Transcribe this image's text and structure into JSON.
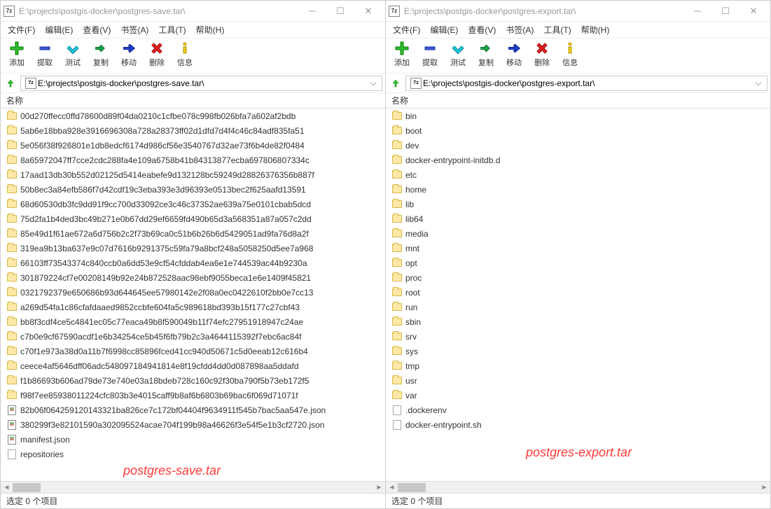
{
  "left": {
    "title": "E:\\projects\\postgis-docker\\postgres-save.tar\\",
    "menu": [
      "文件(F)",
      "编辑(E)",
      "查看(V)",
      "书签(A)",
      "工具(T)",
      "帮助(H)"
    ],
    "toolbar": [
      "添加",
      "提取",
      "测试",
      "复制",
      "移动",
      "删除",
      "信息"
    ],
    "address": "E:\\projects\\postgis-docker\\postgres-save.tar\\",
    "column_header": "名称",
    "items": [
      {
        "type": "folder",
        "name": "00d270ffecc0ffd78600d89f04da0210c1cfbe078c998fb026bfa7a602af2bdb"
      },
      {
        "type": "folder",
        "name": "5ab6e18bba928e3916696308a728a28373ff02d1dfd7d4f4c46c84adf835fa51"
      },
      {
        "type": "folder",
        "name": "5e056f38f926801e1db8edcf6174d986cf56e3540767d32ae73f6b4de82f0484"
      },
      {
        "type": "folder",
        "name": "8a65972047ff7cce2cdc288fa4e109a6758b41b84313877ecba697806807334c"
      },
      {
        "type": "folder",
        "name": "17aad13db30b552d02125d5414eabefe9d132128bc59249d28826376356b887f"
      },
      {
        "type": "folder",
        "name": "50b8ec3a84efb586f7d42cdf19c3eba393e3d96393e0513bec2f625aafd13591"
      },
      {
        "type": "folder",
        "name": "68d60530db3fc9dd91f9cc700d33092ce3c46c37352ae639a75e0101cbab5dcd"
      },
      {
        "type": "folder",
        "name": "75d2fa1b4ded3bc49b271e0b67dd29ef6659fd490b65d3a568351a87a057c2dd"
      },
      {
        "type": "folder",
        "name": "85e49d1f61ae672a6d756b2c2f73b69ca0c51b6b26b6d5429051ad9fa76d8a2f"
      },
      {
        "type": "folder",
        "name": "319ea9b13ba637e9c07d7616b9291375c59fa79a8bcf248a5058250d5ee7a968"
      },
      {
        "type": "folder",
        "name": "66103ff73543374c840ccb0a6dd53e9cf54cfddab4ea6e1e744539ac44b9230a"
      },
      {
        "type": "folder",
        "name": "301879224cf7e00208149b92e24b872528aac98ebf9055beca1e6e1409f45821"
      },
      {
        "type": "folder",
        "name": "0321792379e650686b93d644645ee57980142e2f08a0ec0422610f2bb0e7cc13"
      },
      {
        "type": "folder",
        "name": "a269d54fa1c86cfafdaaed9852ccbfe604fa5c989618bd393b15f177c27cbf43"
      },
      {
        "type": "folder",
        "name": "bb8f3cdf4ce5c4841ec05c77eaca49b8f590049b11f74efc27951918947c24ae"
      },
      {
        "type": "folder",
        "name": "c7b0e9cf67590acdf1e6b34254ce5b45f6fb79b2c3a4644115392f7ebc6ac84f"
      },
      {
        "type": "folder",
        "name": "c70f1e973a38d0a11b7f6998cc85896fced41cc940d50671c5d0eeab12c616b4"
      },
      {
        "type": "folder",
        "name": "ceece4af5646dff06adc548097184941814e8f19cfdd4dd0d087898aa5ddafd"
      },
      {
        "type": "folder",
        "name": "f1b86693b606ad79de73e740e03a18bdeb728c160c92f30ba790f5b73eb172f5"
      },
      {
        "type": "folder",
        "name": "f98f7ee85938011224cfc803b3e4015caff9b8af6b6803b69bac6f069d71071f"
      },
      {
        "type": "json",
        "name": "82b06f064259120143321ba826ce7c172bf04404f9634911f545b7bac5aa547e.json"
      },
      {
        "type": "json",
        "name": "380299f3e82101590a302095524acae704f199b98a46626f3e54f5e1b3cf2720.json"
      },
      {
        "type": "json",
        "name": "manifest.json"
      },
      {
        "type": "file",
        "name": "repositories"
      }
    ],
    "annotation": "postgres-save.tar",
    "status": "选定 0 个项目"
  },
  "right": {
    "title": "E:\\projects\\postgis-docker\\postgres-export.tar\\",
    "menu": [
      "文件(F)",
      "编辑(E)",
      "查看(V)",
      "书签(A)",
      "工具(T)",
      "帮助(H)"
    ],
    "toolbar": [
      "添加",
      "提取",
      "测试",
      "复制",
      "移动",
      "删除",
      "信息"
    ],
    "address": "E:\\projects\\postgis-docker\\postgres-export.tar\\",
    "column_header": "名称",
    "items": [
      {
        "type": "folder",
        "name": "bin"
      },
      {
        "type": "folder",
        "name": "boot"
      },
      {
        "type": "folder",
        "name": "dev"
      },
      {
        "type": "folder",
        "name": "docker-entrypoint-initdb.d"
      },
      {
        "type": "folder",
        "name": "etc"
      },
      {
        "type": "folder",
        "name": "home"
      },
      {
        "type": "folder",
        "name": "lib"
      },
      {
        "type": "folder",
        "name": "lib64"
      },
      {
        "type": "folder",
        "name": "media"
      },
      {
        "type": "folder",
        "name": "mnt"
      },
      {
        "type": "folder",
        "name": "opt"
      },
      {
        "type": "folder",
        "name": "proc"
      },
      {
        "type": "folder",
        "name": "root"
      },
      {
        "type": "folder",
        "name": "run"
      },
      {
        "type": "folder",
        "name": "sbin"
      },
      {
        "type": "folder",
        "name": "srv"
      },
      {
        "type": "folder",
        "name": "sys"
      },
      {
        "type": "folder",
        "name": "tmp"
      },
      {
        "type": "folder",
        "name": "usr"
      },
      {
        "type": "folder",
        "name": "var"
      },
      {
        "type": "file",
        "name": ".dockerenv"
      },
      {
        "type": "file",
        "name": "docker-entrypoint.sh"
      }
    ],
    "annotation": "postgres-export.tar",
    "status": "选定 0 个项目"
  },
  "icons": {
    "add": {
      "fill": "#2dbe2d",
      "stroke": "#0a7a0a"
    },
    "extract": {
      "fill": "#3a5ae0",
      "stroke": "#1a2a90"
    },
    "test": {
      "fill": "#1ec8e0",
      "stroke": "#0a7a90"
    },
    "copy": {
      "fill": "#1aa84a",
      "stroke": "#0a6a2a"
    },
    "move": {
      "fill": "#2040d0",
      "stroke": "#10208a"
    },
    "delete": {
      "fill": "#e02020",
      "stroke": "#9a1010"
    },
    "info": {
      "fill": "#f0d020",
      "stroke": "#b09000"
    }
  }
}
